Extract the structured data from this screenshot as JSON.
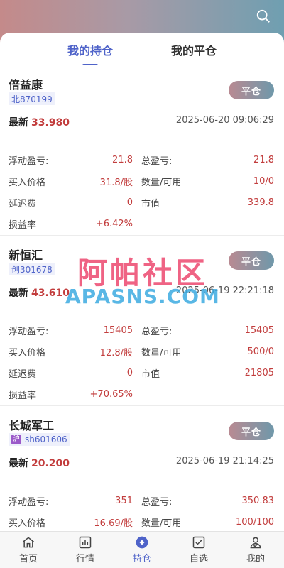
{
  "tabs": [
    "我的持仓",
    "我的平仓"
  ],
  "close_label": "平仓",
  "labels": {
    "latest": "最新",
    "float_pnl": "浮动盈亏:",
    "total_pnl": "总盈亏:",
    "buy_price": "买入价格",
    "qty": "数量/可用",
    "delay_fee": "延迟费",
    "market_value": "市值",
    "pnl_rate": "损益率"
  },
  "positions": [
    {
      "name": "倍益康",
      "code": "北870199",
      "market_badge": "",
      "latest": "33.980",
      "time": "2025-06-20 09:06:29",
      "float_pnl": "21.8",
      "total_pnl": "21.8",
      "buy_price": "31.8/股",
      "qty": "10/0",
      "delay_fee": "0",
      "market_value": "339.8",
      "pnl_rate": "+6.42%"
    },
    {
      "name": "新恒汇",
      "code": "创301678",
      "market_badge": "",
      "latest": "43.610",
      "time": "2025-06-19 22:21:18",
      "float_pnl": "15405",
      "total_pnl": "15405",
      "buy_price": "12.8/股",
      "qty": "500/0",
      "delay_fee": "0",
      "market_value": "21805",
      "pnl_rate": "+70.65%"
    },
    {
      "name": "长城军工",
      "code": "sh601606",
      "market_badge": "沪",
      "latest": "20.200",
      "time": "2025-06-19 21:14:25",
      "float_pnl": "351",
      "total_pnl": "350.83",
      "buy_price": "16.69/股",
      "qty": "100/100"
    }
  ],
  "watermark": {
    "cn": "阿帕社区",
    "en": "APASNS.COM"
  },
  "tabbar": [
    {
      "label": "首页",
      "icon": "home-icon"
    },
    {
      "label": "行情",
      "icon": "chart-icon"
    },
    {
      "label": "持仓",
      "icon": "position-icon"
    },
    {
      "label": "自选",
      "icon": "checkbox-icon"
    },
    {
      "label": "我的",
      "icon": "user-icon"
    }
  ],
  "colors": {
    "accent": "#4f63c9",
    "profit": "#c23d3d"
  }
}
